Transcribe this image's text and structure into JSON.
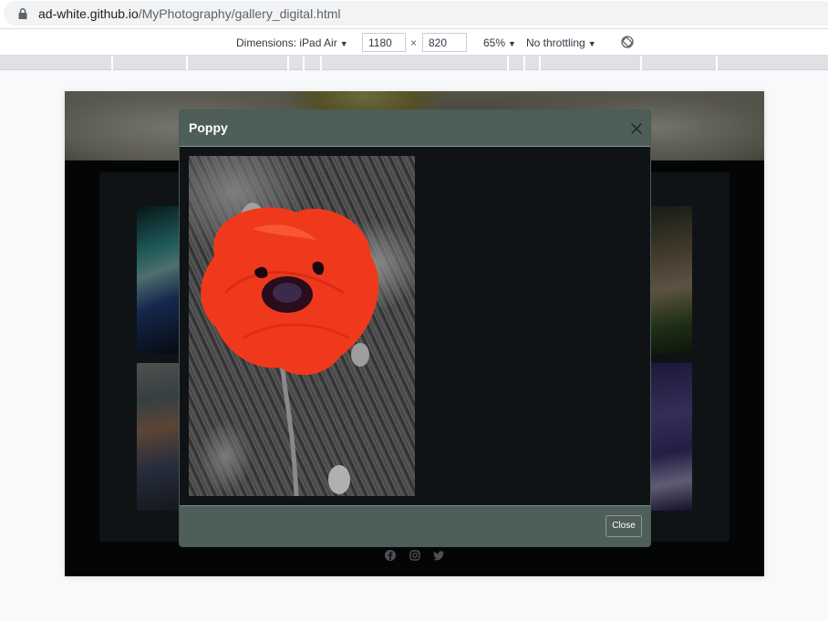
{
  "browser": {
    "url_host": "ad-white.github.io",
    "url_path": "/MyPhotography/gallery_digital.html"
  },
  "devtools": {
    "dimensions_label": "Dimensions: iPad Air",
    "width": "1180",
    "height": "820",
    "times": "×",
    "zoom": "65%",
    "throttling": "No throttling",
    "caret": "▼"
  },
  "modal": {
    "title": "Poppy",
    "close_button": "Close",
    "image_subject": "red poppy flower on grayscale foliage"
  },
  "colors": {
    "modal_header": "#4e5e58",
    "modal_body": "#101316",
    "poppy_red": "#f0391c"
  },
  "footer": {
    "social_icons": [
      "facebook-icon",
      "instagram-icon",
      "twitter-icon"
    ]
  }
}
